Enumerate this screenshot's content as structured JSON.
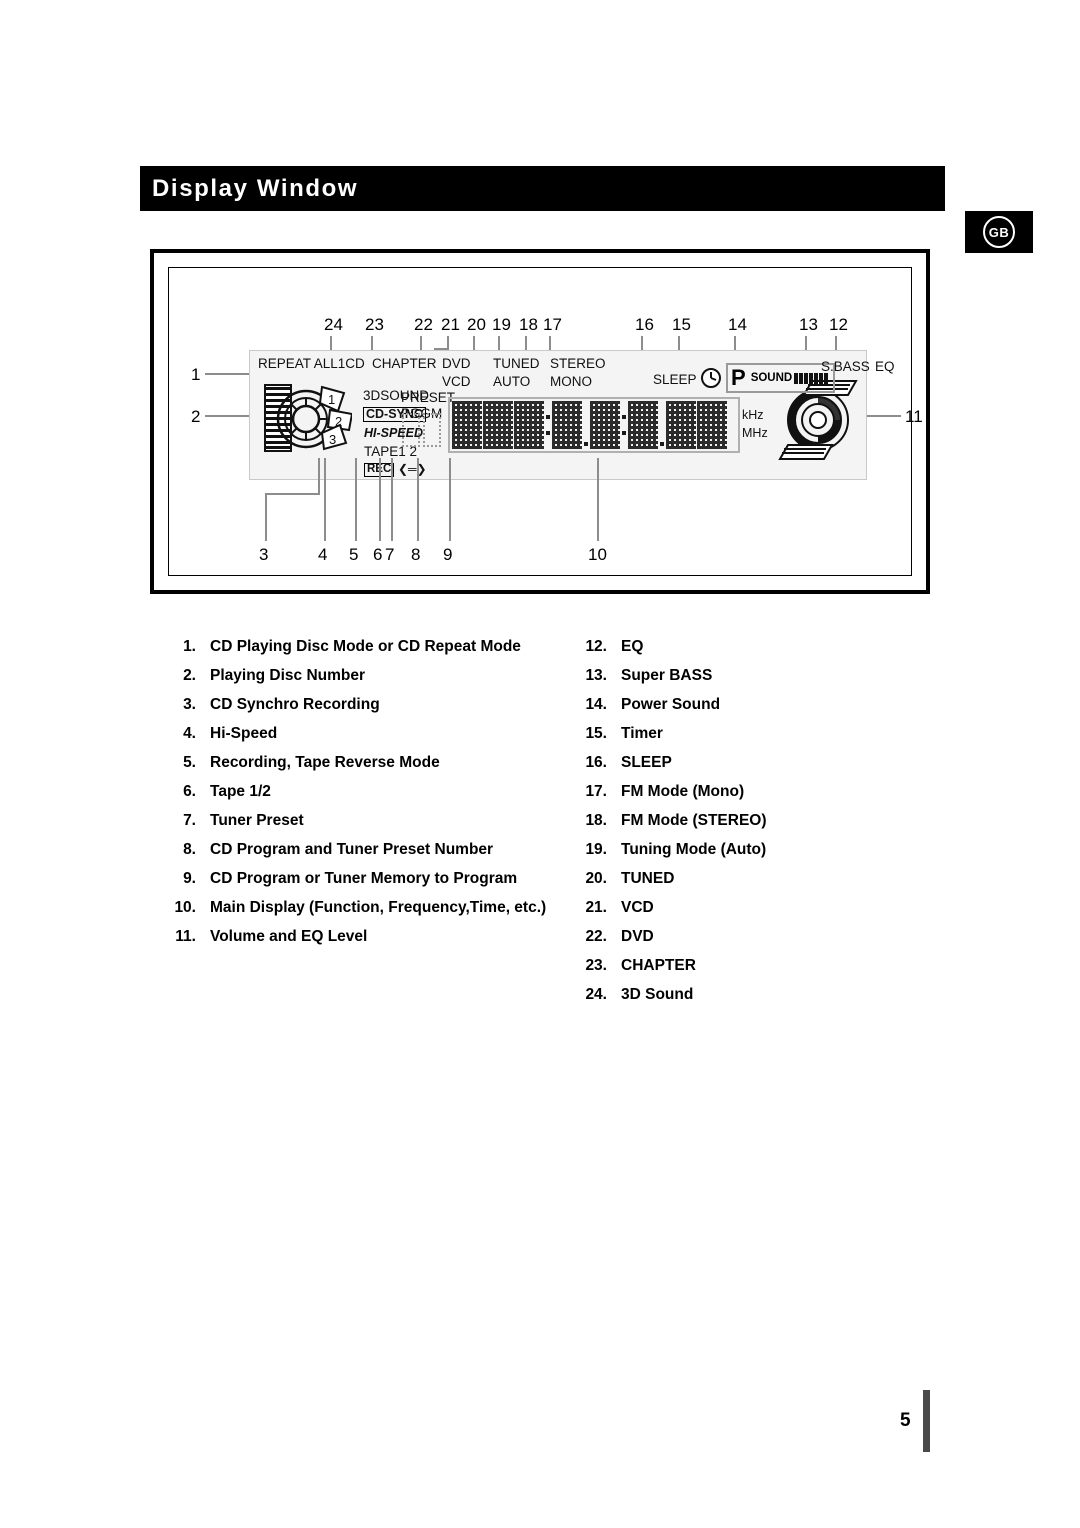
{
  "header": {
    "title": "Display Window",
    "region_badge": "GB"
  },
  "diagram": {
    "top_callouts": [
      "24",
      "23",
      "22",
      "21",
      "20",
      "19",
      "18",
      "17",
      "16",
      "15",
      "14",
      "13",
      "12"
    ],
    "left_callouts": [
      "1",
      "2"
    ],
    "right_callouts": [
      "11"
    ],
    "bottom_callouts": [
      "3",
      "4",
      "5",
      "6",
      "7",
      "8",
      "9",
      "10"
    ],
    "lcd_labels": {
      "repeat": "REPEAT ALL1CD",
      "chapter": "CHAPTER",
      "dvd": "DVD",
      "vcd": "VCD",
      "tuned": "TUNED",
      "auto": "AUTO",
      "stereo": "STEREO",
      "mono": "MONO",
      "sleep": "SLEEP",
      "three_d_sound": "3DSOUND",
      "cd_sync": "CD-SYNC",
      "hi_speed": "HI-SPEED",
      "tape": "TAPE1 2",
      "rec": "REC",
      "rec_arrows": "❮═❯",
      "preset": "PRESET",
      "pggm": "PGGM",
      "p_indicator": "P",
      "sound": "SOUND",
      "s_bass": "S.BASS",
      "eq": "EQ",
      "khz": "kHz",
      "mhz": "MHz",
      "disc_numbers": [
        "1",
        "2",
        "3"
      ]
    },
    "main_display": {
      "cell_count": 8,
      "separators": [
        "colon",
        "period",
        "colon",
        "period"
      ]
    },
    "sound_bar_segments": 7
  },
  "legend": {
    "left": [
      {
        "num": "1.",
        "text": "CD Playing Disc Mode or CD Repeat Mode"
      },
      {
        "num": "2.",
        "text": "Playing Disc Number"
      },
      {
        "num": "3.",
        "text": "CD Synchro Recording"
      },
      {
        "num": "4.",
        "text": "Hi-Speed"
      },
      {
        "num": "5.",
        "text": "Recording, Tape Reverse Mode"
      },
      {
        "num": "6.",
        "text": "Tape 1/2"
      },
      {
        "num": "7.",
        "text": "Tuner Preset"
      },
      {
        "num": "8.",
        "text": "CD Program and Tuner Preset Number"
      },
      {
        "num": "9.",
        "text": "CD Program or Tuner Memory to Program"
      },
      {
        "num": "10.",
        "text": "Main Display (Function, Frequency,Time, etc.)"
      },
      {
        "num": "11.",
        "text": "Volume and EQ Level"
      }
    ],
    "right": [
      {
        "num": "12.",
        "text": "EQ"
      },
      {
        "num": "13.",
        "text": "Super BASS"
      },
      {
        "num": "14.",
        "text": "Power Sound"
      },
      {
        "num": "15.",
        "text": "Timer"
      },
      {
        "num": "16.",
        "text": "SLEEP"
      },
      {
        "num": "17.",
        "text": "FM Mode (Mono)"
      },
      {
        "num": "18.",
        "text": "FM Mode (STEREO)"
      },
      {
        "num": "19.",
        "text": "Tuning  Mode (Auto)"
      },
      {
        "num": "20.",
        "text": "TUNED"
      },
      {
        "num": "21.",
        "text": "VCD"
      },
      {
        "num": "22.",
        "text": "DVD"
      },
      {
        "num": "23.",
        "text": "CHAPTER"
      },
      {
        "num": "24.",
        "text": "3D Sound"
      }
    ]
  },
  "footer": {
    "page_number": "5"
  },
  "colors": {
    "header_bg": "#000000",
    "header_text": "#ffffff",
    "lcd_bg": "#f4f4f4",
    "leader_line": "#8d8d8d",
    "footer_bar": "#4a4a4a"
  }
}
